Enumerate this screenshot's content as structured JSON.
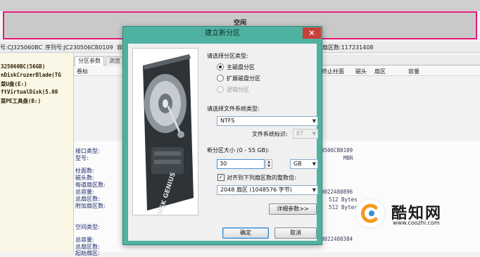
{
  "background": {
    "disk_bar_label": "空闲",
    "info": {
      "model": "号:CJ325060BC",
      "serial": "序列号:JC230506CB0109",
      "stub": "容",
      "sectors": "扇区数:117231408"
    },
    "tree": [
      "325060BC(56GB)",
      "nDiskCruzerBlade(TG",
      "菜U盘(E:)",
      "ftVirtualDisk(5.00",
      "菜PE工具盘(B:)"
    ],
    "tabs": [
      "分区参数",
      "浏览"
    ],
    "grid_headers": [
      "卷标",
      "终止柱面",
      "磁头",
      "扇区",
      "容量"
    ],
    "lower_labels": [
      "接口类型:",
      "型号:",
      "柱面数:",
      "磁头数:",
      "每道扇区数:",
      "总容量:",
      "总扇区数:",
      "附加扇区数:",
      "空间类型:",
      "总容量:",
      "总扇区数:",
      "起始扇区:"
    ],
    "lower_values": [
      "0506CB0109",
      "MBR",
      "0022480896",
      "512 Bytes",
      "512 Bytes",
      "0022480384"
    ]
  },
  "dialog": {
    "title": "建立新分区",
    "close_label": "×",
    "partition_type_label": "请选择分区类型:",
    "partition_types": [
      {
        "label": "主磁盘分区",
        "selected": true,
        "disabled": false
      },
      {
        "label": "扩展磁盘分区",
        "selected": false,
        "disabled": false
      },
      {
        "label": "逻辑分区",
        "selected": false,
        "disabled": true
      }
    ],
    "fs_type_label": "请选择文件系统类型:",
    "fs_type_value": "NTFS",
    "fs_id_label": "文件系统标识:",
    "fs_id_value": "07",
    "size_label": "新分区大小 (0 - 55 GB):",
    "size_value": "30",
    "size_unit": "GB",
    "align_label": "对齐到下列扇区数的整数倍:",
    "align_checked": true,
    "align_value": "2048 扇区 (1048576 字节)",
    "details_button": "详细参数>>",
    "ok_button": "确定",
    "cancel_button": "取消",
    "image_text": "DISK GENIUS"
  },
  "watermark": {
    "brand": "酷知网",
    "url": "www.coozhi.com"
  },
  "colors": {
    "dialog_frame": "#4fb2a0",
    "highlight_border": "#e4197a",
    "close_button": "#c8403a"
  }
}
